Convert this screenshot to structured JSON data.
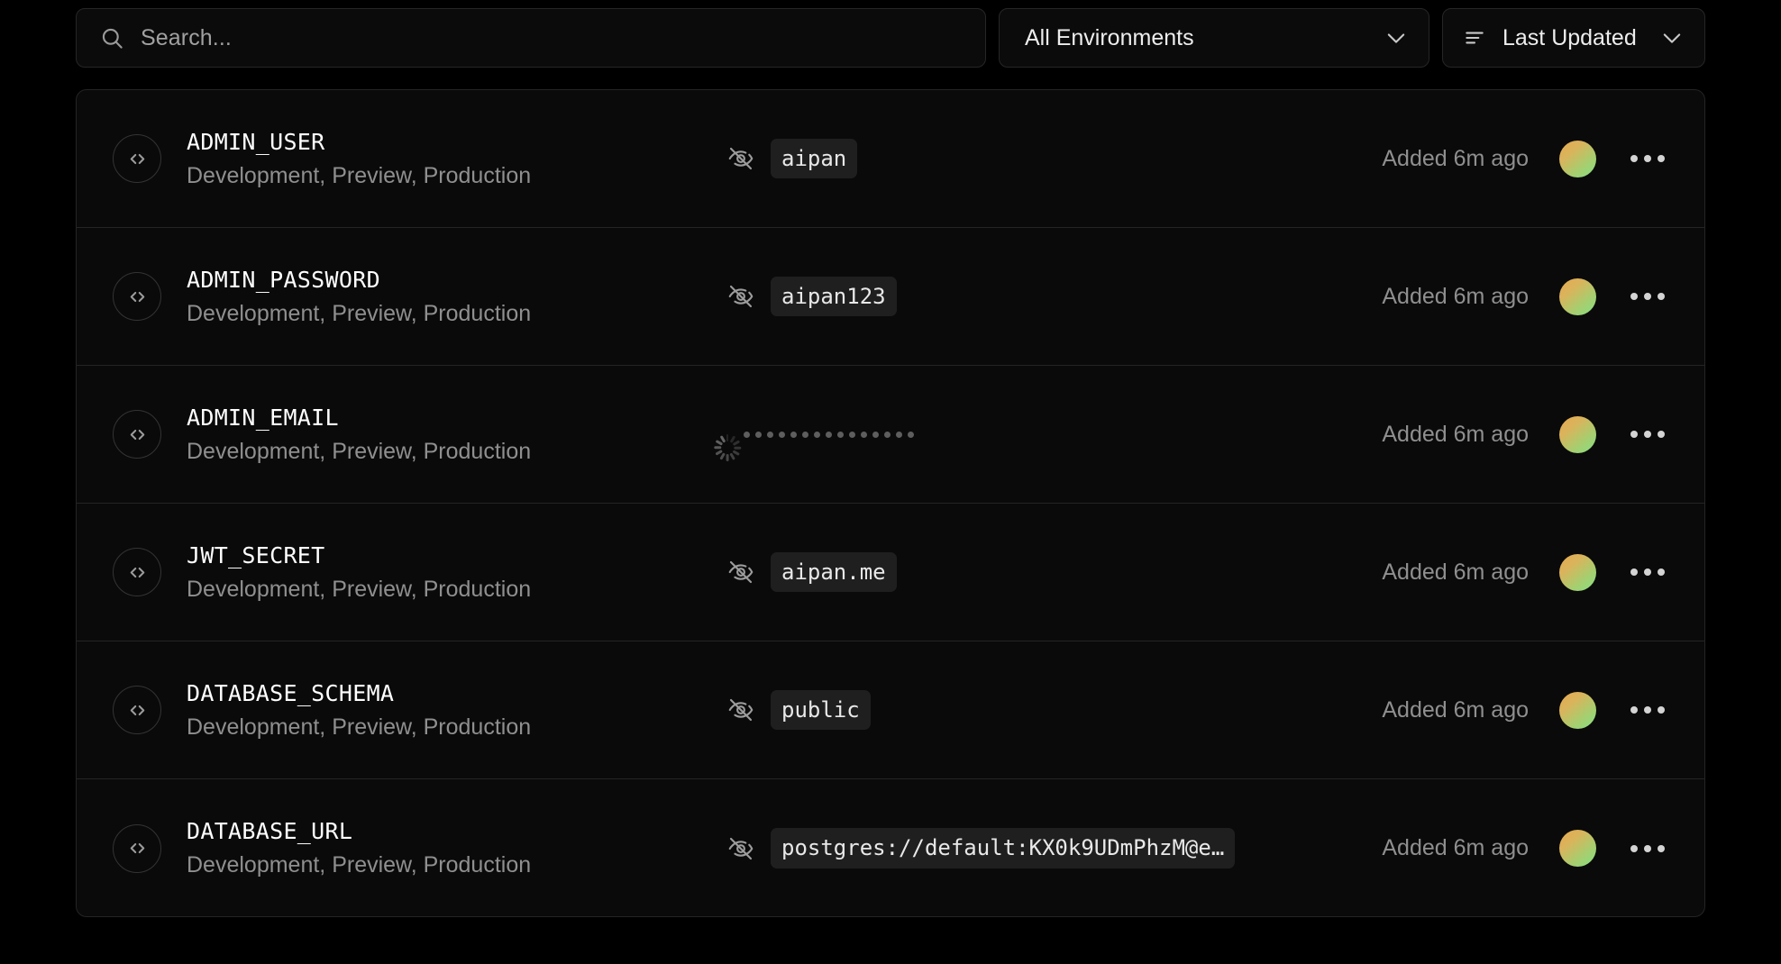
{
  "search": {
    "placeholder": "Search...",
    "value": "",
    "icon": "search-icon"
  },
  "filters": {
    "environment": {
      "label": "All Environments",
      "icon": "chevron-down-icon"
    },
    "sort": {
      "label": "Last Updated",
      "leading_icon": "sort-lines-icon",
      "icon": "chevron-down-icon"
    }
  },
  "colors": {
    "page_background": "#000000",
    "card_background": "#0a0a0a",
    "border": "#242424",
    "chip_background": "#1f1f1f",
    "key_text": "#ffffff",
    "muted_text": "#8f8f8f",
    "avatar_gradient_start": "#e8a84e",
    "avatar_gradient_end": "#84e083"
  },
  "rows": [
    {
      "key": "ADMIN_USER",
      "environments": "Development, Preview, Production",
      "value": "aipan",
      "value_state": "hidden",
      "reveal_icon": "eye-off-icon",
      "added": "Added 6m ago",
      "row_icon": "code-brackets-icon",
      "menu_icon": "more-horizontal-icon"
    },
    {
      "key": "ADMIN_PASSWORD",
      "environments": "Development, Preview, Production",
      "value": "aipan123",
      "value_state": "hidden",
      "reveal_icon": "eye-off-icon",
      "added": "Added 6m ago",
      "row_icon": "code-brackets-icon",
      "menu_icon": "more-horizontal-icon"
    },
    {
      "key": "ADMIN_EMAIL",
      "environments": "Development, Preview, Production",
      "value": "",
      "value_state": "loading",
      "masked_dot_count": 15,
      "reveal_icon": "loading-spinner-icon",
      "added": "Added 6m ago",
      "row_icon": "code-brackets-icon",
      "menu_icon": "more-horizontal-icon"
    },
    {
      "key": "JWT_SECRET",
      "environments": "Development, Preview, Production",
      "value": "aipan.me",
      "value_state": "hidden",
      "reveal_icon": "eye-off-icon",
      "added": "Added 6m ago",
      "row_icon": "code-brackets-icon",
      "menu_icon": "more-horizontal-icon"
    },
    {
      "key": "DATABASE_SCHEMA",
      "environments": "Development, Preview, Production",
      "value": "public",
      "value_state": "hidden",
      "reveal_icon": "eye-off-icon",
      "added": "Added 6m ago",
      "row_icon": "code-brackets-icon",
      "menu_icon": "more-horizontal-icon"
    },
    {
      "key": "DATABASE_URL",
      "environments": "Development, Preview, Production",
      "value": "postgres://default:KX0k9UDmPhzM@e…",
      "value_state": "hidden",
      "reveal_icon": "eye-off-icon",
      "added": "Added 6m ago",
      "row_icon": "code-brackets-icon",
      "menu_icon": "more-horizontal-icon"
    }
  ]
}
